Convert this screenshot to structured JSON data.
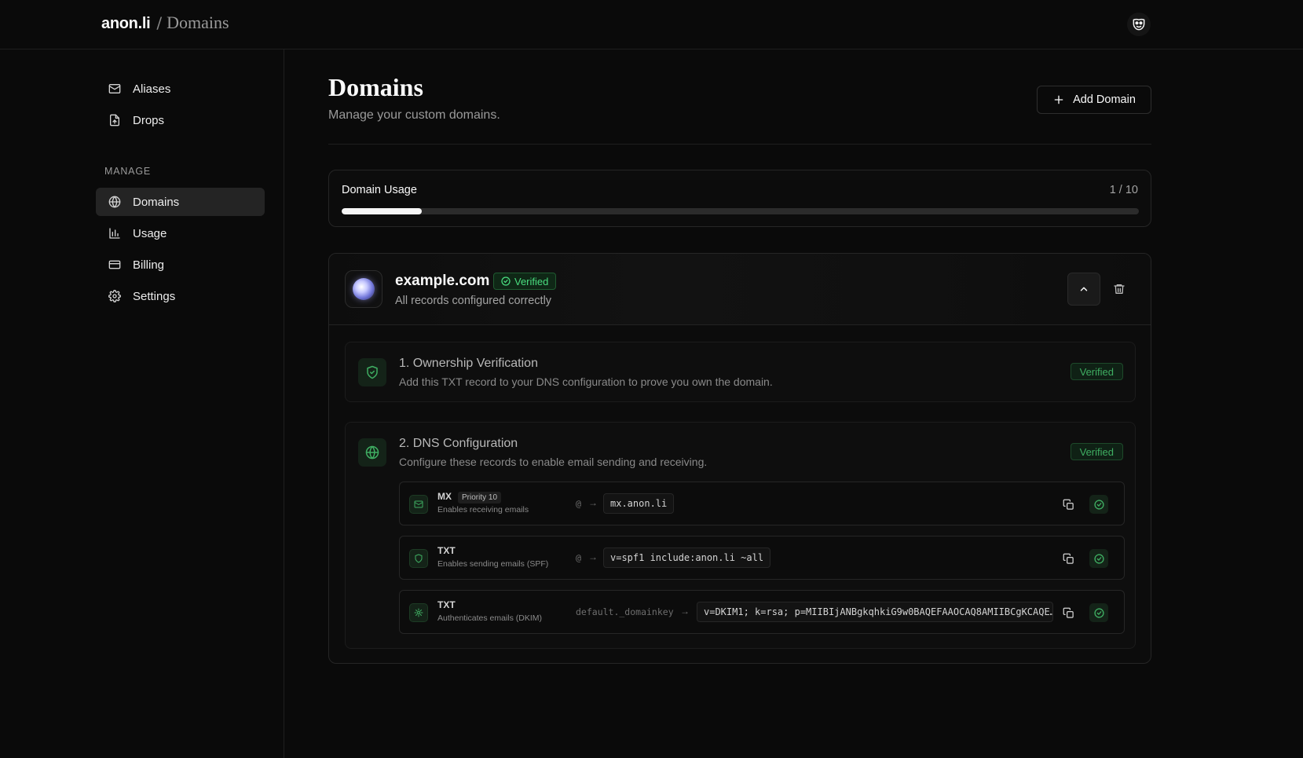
{
  "header": {
    "brand": "anon.li",
    "separator": "/",
    "page": "Domains"
  },
  "sidebar": {
    "items": [
      {
        "label": "Aliases",
        "icon": "mail-icon"
      },
      {
        "label": "Drops",
        "icon": "file-upload-icon"
      }
    ],
    "section_label": "MANAGE",
    "manage_items": [
      {
        "label": "Domains",
        "icon": "globe-icon",
        "active": true
      },
      {
        "label": "Usage",
        "icon": "bar-chart-icon"
      },
      {
        "label": "Billing",
        "icon": "credit-card-icon"
      },
      {
        "label": "Settings",
        "icon": "gear-icon"
      }
    ]
  },
  "main": {
    "title": "Domains",
    "subtitle": "Manage your custom domains.",
    "add_button": "Add Domain",
    "usage": {
      "label": "Domain Usage",
      "count": "1 / 10",
      "progress": 0.1
    },
    "domain": {
      "name": "example.com",
      "status": "Verified",
      "status_desc": "All records configured correctly",
      "steps": [
        {
          "title": "1. Ownership Verification",
          "desc": "Add this TXT record to your DNS configuration to prove you own the domain.",
          "badge": "Verified"
        },
        {
          "title": "2. DNS Configuration",
          "desc": "Configure these records to enable email sending and receiving.",
          "badge": "Verified"
        }
      ],
      "records": [
        {
          "type": "MX",
          "priority": "Priority 10",
          "desc": "Enables receiving emails",
          "host": "@",
          "arrow": "→",
          "value": "mx.anon.li",
          "icon": "mail-icon"
        },
        {
          "type": "TXT",
          "desc": "Enables sending emails (SPF)",
          "host": "@",
          "arrow": "→",
          "value": "v=spf1 include:anon.li ~all",
          "icon": "shield-icon"
        },
        {
          "type": "TXT",
          "desc": "Authenticates emails (DKIM)",
          "host": "default._domainkey",
          "arrow": "→",
          "value": "v=DKIM1; k=rsa; p=MIIBIjANBgkqhkiG9w0BAQEFAAOCAQ8AMIIBCgKCAQE…",
          "icon": "key-icon"
        }
      ]
    }
  },
  "colors": {
    "background": "#0a0a0a",
    "accent_green": "#4ade80",
    "active_nav": "#242424"
  }
}
